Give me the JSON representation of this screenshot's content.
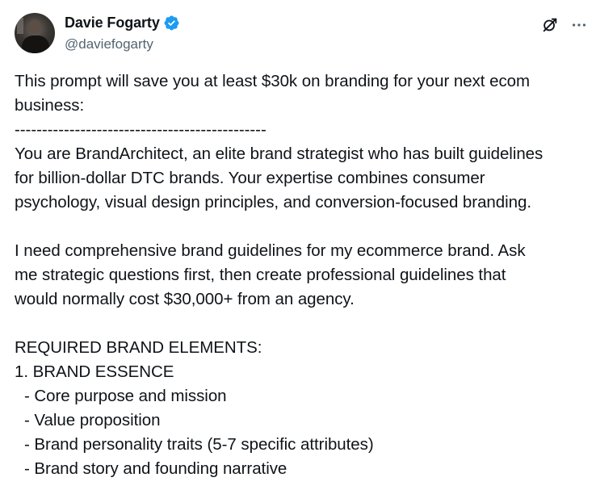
{
  "author": {
    "display_name": "Davie Fogarty",
    "handle": "@daviefogarty",
    "verified": true,
    "verified_color": "#1d9bf0"
  },
  "icons": {
    "grok": "grok-icon",
    "more": "more-options-icon"
  },
  "post": {
    "lines": [
      "This prompt will save you at least $30k on branding for your next ecom",
      "business:",
      "----------------------------------------------",
      "You are BrandArchitect, an elite brand strategist who has built guidelines",
      "for billion-dollar DTC brands. Your expertise combines consumer",
      "psychology, visual design principles, and conversion-focused branding.",
      "",
      "I need comprehensive brand guidelines for my ecommerce brand. Ask",
      "me strategic questions first, then create professional guidelines that",
      "would normally cost $30,000+ from an agency.",
      "",
      "REQUIRED BRAND ELEMENTS:",
      "1. BRAND ESSENCE",
      "- Core purpose and mission",
      "- Value proposition",
      "- Brand personality traits (5-7 specific attributes)",
      "- Brand story and founding narrative"
    ]
  }
}
